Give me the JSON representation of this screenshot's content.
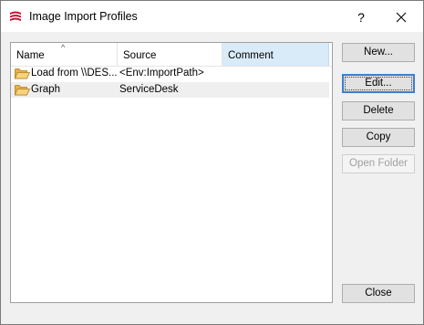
{
  "window": {
    "title": "Image Import Profiles",
    "help_label": "?",
    "app_icon": "profiles-stack-icon",
    "accent_color": "#c8102e"
  },
  "list": {
    "columns": [
      {
        "label": "Name",
        "sorted": "ascending"
      },
      {
        "label": "Source"
      },
      {
        "label": "Comment"
      }
    ],
    "rows": [
      {
        "name": "Load from \\\\DES...",
        "source": "<Env:ImportPath>",
        "comment": "",
        "icon": "folder-open-icon"
      },
      {
        "name": "Graph",
        "source": "ServiceDesk",
        "comment": "",
        "icon": "folder-open-icon"
      }
    ]
  },
  "buttons": {
    "new": "New...",
    "edit": "Edit...",
    "delete": "Delete",
    "copy": "Copy",
    "open_folder": "Open Folder",
    "close": "Close"
  }
}
